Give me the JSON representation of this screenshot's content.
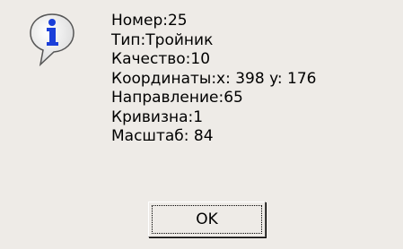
{
  "dialog": {
    "icon": "info-icon",
    "lines": [
      "Номер:25",
      "Тип:Тройник",
      "Качество:10",
      "Координаты:x: 398 y: 176",
      "Направление:65",
      "Кривизна:1",
      "Масштаб: 84"
    ],
    "ok_label": "OK"
  },
  "colors": {
    "background": "#eeebe7",
    "icon_blue": "#1a3fd9",
    "icon_fill": "#ffffff"
  }
}
